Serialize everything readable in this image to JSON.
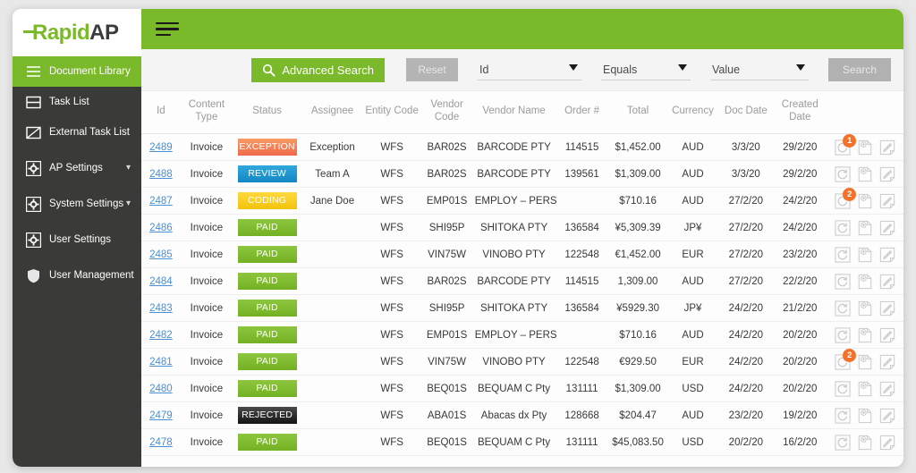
{
  "brand": {
    "name_part1": "Rapid",
    "name_part2": "AP",
    "green": "#7ab929",
    "dark": "#3b3b3b"
  },
  "sidebar": {
    "items": [
      {
        "label": "Document Library",
        "icon": "hamburger-icon",
        "active": true,
        "chevron": ""
      },
      {
        "label": "Task List",
        "icon": "list-icon",
        "active": false,
        "chevron": ""
      },
      {
        "label": "External Task List",
        "icon": "external-icon",
        "active": false,
        "chevron": ""
      },
      {
        "label": "AP Settings",
        "icon": "gear-icon",
        "active": false,
        "chevron": "⌄"
      },
      {
        "label": "System Settings",
        "icon": "gear-icon",
        "active": false,
        "chevron": "⌄"
      },
      {
        "label": "User Settings",
        "icon": "gear-icon",
        "active": false,
        "chevron": ""
      },
      {
        "label": "User Management",
        "icon": "shield-icon",
        "active": false,
        "chevron": ""
      }
    ]
  },
  "topbar": {
    "menu_icon": "hamburger-icon"
  },
  "search": {
    "advanced_search_label": "Advanced Search",
    "search_icon": "search-icon",
    "reset_label": "Reset",
    "field_value": "Id",
    "operator_value": "Equals",
    "value_value": "Value",
    "search_label": "Search"
  },
  "table": {
    "columns": [
      "Id",
      "Content Type",
      "Status",
      "Assignee",
      "Entity Code",
      "Vendor Code",
      "Vendor Name",
      "Order #",
      "Total",
      "Currency",
      "Doc Date",
      "Created Date",
      ""
    ],
    "rows": [
      {
        "id": "2489",
        "content_type": "Invoice",
        "status": "EXCEPTION",
        "status_class": "exception",
        "assignee": "Exception",
        "entity_code": "WFS",
        "vendor_code": "BAR02S",
        "vendor_name": "BARCODE PTY",
        "order": "114515",
        "total": "$1,452.00",
        "currency": "AUD",
        "doc_date": "3/3/20",
        "created_date": "29/2/20",
        "alert_count": "1"
      },
      {
        "id": "2488",
        "content_type": "Invoice",
        "status": "REVIEW",
        "status_class": "review",
        "assignee": "Team A",
        "entity_code": "WFS",
        "vendor_code": "BAR02S",
        "vendor_name": "BARCODE PTY",
        "order": "139561",
        "total": "$1,309.00",
        "currency": "AUD",
        "doc_date": "3/3/20",
        "created_date": "29/2/20",
        "alert_count": ""
      },
      {
        "id": "2487",
        "content_type": "Invoice",
        "status": "CODING",
        "status_class": "coding",
        "assignee": "Jane Doe",
        "entity_code": "WFS",
        "vendor_code": "EMP01S",
        "vendor_name": "EMPLOY – PERS",
        "order": "",
        "total": "$710.16",
        "currency": "AUD",
        "doc_date": "27/2/20",
        "created_date": "24/2/20",
        "alert_count": "2"
      },
      {
        "id": "2486",
        "content_type": "Invoice",
        "status": "PAID",
        "status_class": "paid",
        "assignee": "",
        "entity_code": "WFS",
        "vendor_code": "SHI95P",
        "vendor_name": "SHITOKA PTY",
        "order": "136584",
        "total": "¥5,309.39",
        "currency": "JP¥",
        "doc_date": "27/2/20",
        "created_date": "24/2/20",
        "alert_count": ""
      },
      {
        "id": "2485",
        "content_type": "Invoice",
        "status": "PAID",
        "status_class": "paid",
        "assignee": "",
        "entity_code": "WFS",
        "vendor_code": "VIN75W",
        "vendor_name": "VINOBO PTY",
        "order": "122548",
        "total": "€1,452.00",
        "currency": "EUR",
        "doc_date": "27/2/20",
        "created_date": "23/2/20",
        "alert_count": ""
      },
      {
        "id": "2484",
        "content_type": "Invoice",
        "status": "PAID",
        "status_class": "paid",
        "assignee": "",
        "entity_code": "WFS",
        "vendor_code": "BAR02S",
        "vendor_name": "BARCODE PTY",
        "order": "114515",
        "total": "1,309.00",
        "currency": "AUD",
        "doc_date": "27/2/20",
        "created_date": "22/2/20",
        "alert_count": ""
      },
      {
        "id": "2483",
        "content_type": "Invoice",
        "status": "PAID",
        "status_class": "paid",
        "assignee": "",
        "entity_code": "WFS",
        "vendor_code": "SHI95P",
        "vendor_name": "SHITOKA PTY",
        "order": "136584",
        "total": "¥5929.30",
        "currency": "JP¥",
        "doc_date": "24/2/20",
        "created_date": "21/2/20",
        "alert_count": ""
      },
      {
        "id": "2482",
        "content_type": "Invoice",
        "status": "PAID",
        "status_class": "paid",
        "assignee": "",
        "entity_code": "WFS",
        "vendor_code": "EMP01S",
        "vendor_name": "EMPLOY – PERS",
        "order": "",
        "total": "$710.16",
        "currency": "AUD",
        "doc_date": "24/2/20",
        "created_date": "20/2/20",
        "alert_count": ""
      },
      {
        "id": "2481",
        "content_type": "Invoice",
        "status": "PAID",
        "status_class": "paid",
        "assignee": "",
        "entity_code": "WFS",
        "vendor_code": "VIN75W",
        "vendor_name": "VINOBO PTY",
        "order": "122548",
        "total": "€929.50",
        "currency": "EUR",
        "doc_date": "24/2/20",
        "created_date": "20/2/20",
        "alert_count": "2"
      },
      {
        "id": "2480",
        "content_type": "Invoice",
        "status": "PAID",
        "status_class": "paid",
        "assignee": "",
        "entity_code": "WFS",
        "vendor_code": "BEQ01S",
        "vendor_name": "BEQUAM C Pty",
        "order": "131111",
        "total": "$1,309.00",
        "currency": "USD",
        "doc_date": "24/2/20",
        "created_date": "20/2/20",
        "alert_count": ""
      },
      {
        "id": "2479",
        "content_type": "Invoice",
        "status": "REJECTED",
        "status_class": "rejected",
        "assignee": "",
        "entity_code": "WFS",
        "vendor_code": "ABA01S",
        "vendor_name": "Abacas dx Pty",
        "order": "128668",
        "total": "$204.47",
        "currency": "AUD",
        "doc_date": "23/2/20",
        "created_date": "19/2/20",
        "alert_count": ""
      },
      {
        "id": "2478",
        "content_type": "Invoice",
        "status": "PAID",
        "status_class": "paid",
        "assignee": "",
        "entity_code": "WFS",
        "vendor_code": "BEQ01S",
        "vendor_name": "BEQUAM C Pty",
        "order": "131111",
        "total": "$45,083.50",
        "currency": "USD",
        "doc_date": "20/2/20",
        "created_date": "16/2/20",
        "alert_count": ""
      }
    ],
    "action_icons": [
      "history-refresh-icon",
      "add-document-icon",
      "edit-pencil-icon"
    ]
  }
}
